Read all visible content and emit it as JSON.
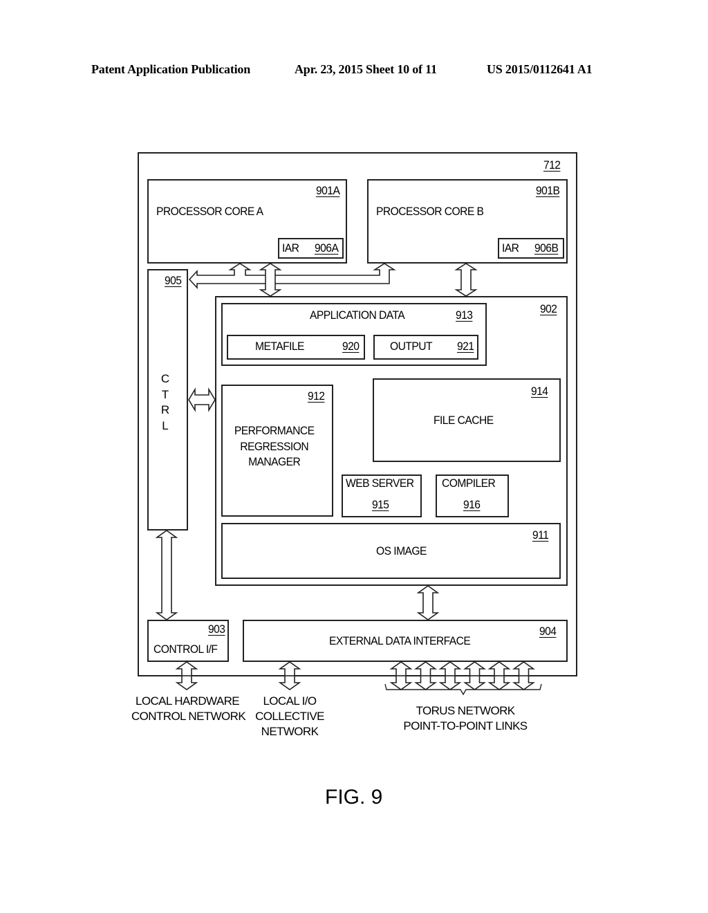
{
  "header": {
    "publication": "Patent Application Publication",
    "date_sheet": "Apr. 23, 2015  Sheet 10 of 11",
    "number": "US 2015/0112641 A1"
  },
  "diagram": {
    "outer": {
      "ref": "712"
    },
    "core_a": {
      "label": "PROCESSOR CORE A",
      "ref": "901A",
      "iar_label": "IAR",
      "iar_ref": "906A"
    },
    "core_b": {
      "label": "PROCESSOR CORE B",
      "ref": "901B",
      "iar_label": "IAR",
      "iar_ref": "906B"
    },
    "ctrl": {
      "ref": "905",
      "letters": [
        "C",
        "T",
        "R",
        "L"
      ]
    },
    "memory": {
      "ref": "902"
    },
    "app_data": {
      "label": "APPLICATION DATA",
      "ref": "913"
    },
    "metafile": {
      "label": "METAFILE",
      "ref": "920"
    },
    "output": {
      "label": "OUTPUT",
      "ref": "921"
    },
    "prm": {
      "label_lines": [
        "PERFORMANCE",
        "REGRESSION",
        "MANAGER"
      ],
      "ref": "912"
    },
    "file_cache": {
      "label": "FILE CACHE",
      "ref": "914"
    },
    "web_server": {
      "label": "WEB SERVER",
      "ref": "915"
    },
    "compiler": {
      "label": "COMPILER",
      "ref": "916"
    },
    "os_image": {
      "label": "OS IMAGE",
      "ref": "911"
    },
    "control_if": {
      "label": "CONTROL I/F",
      "ref": "903"
    },
    "ext_data_if": {
      "label": "EXTERNAL DATA INTERFACE",
      "ref": "904"
    },
    "external_links": {
      "hw_control": [
        "LOCAL HARDWARE",
        "CONTROL NETWORK"
      ],
      "io_collective": [
        "LOCAL I/O",
        "COLLECTIVE",
        "NETWORK"
      ],
      "torus": [
        "TORUS NETWORK",
        "POINT-TO-POINT LINKS"
      ],
      "torus_link_count": 6
    }
  },
  "figure_label": "FIG. 9"
}
